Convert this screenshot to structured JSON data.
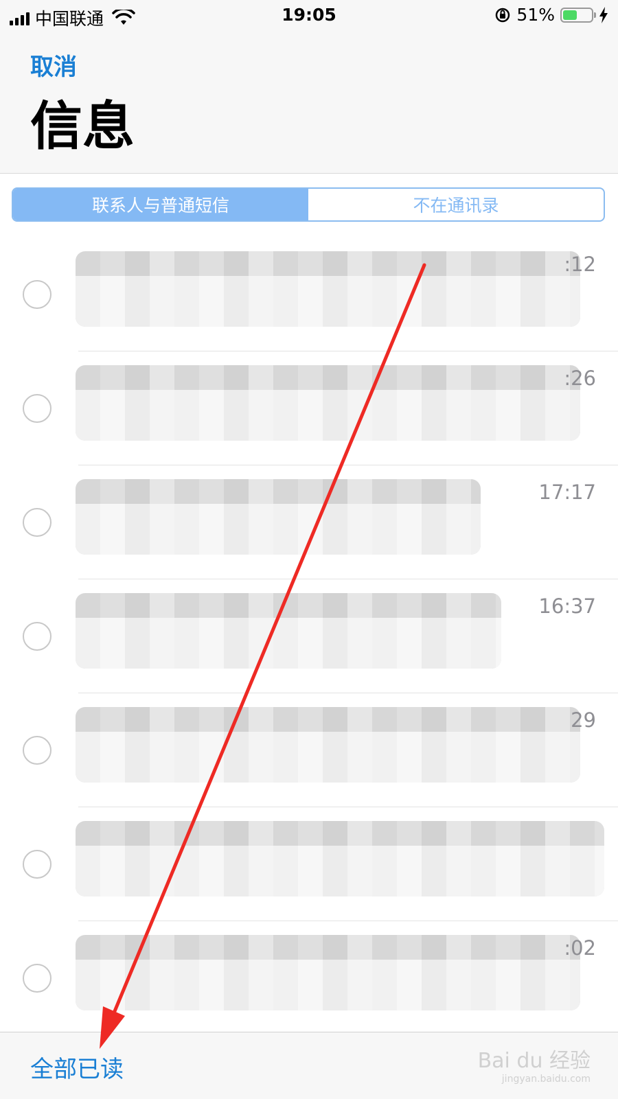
{
  "status_bar": {
    "carrier": "中国联通",
    "time": "19:05",
    "battery_percent": "51%",
    "battery_level": 0.51
  },
  "header": {
    "cancel_label": "取消",
    "title": "信息"
  },
  "segmented_control": {
    "tabs": [
      {
        "label": "联系人与普通短信",
        "selected": true
      },
      {
        "label": "不在通讯录",
        "selected": false
      }
    ]
  },
  "messages": [
    {
      "time": ":12"
    },
    {
      "time": ":26"
    },
    {
      "time": "17:17"
    },
    {
      "time": "16:37"
    },
    {
      "time": "29"
    },
    {
      "time": ""
    },
    {
      "time": ":02"
    }
  ],
  "toolbar": {
    "read_all_label": "全部已读"
  },
  "watermark": {
    "text": "Bai du 经验",
    "sub": "jingyan.baidu.com"
  },
  "colors": {
    "accent": "#1a7fd4",
    "segment_active": "#84b9f4",
    "annotation_arrow": "#ee2a24"
  }
}
